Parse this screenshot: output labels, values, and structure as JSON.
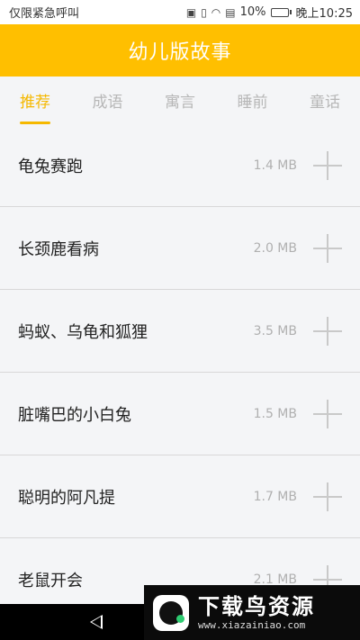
{
  "status_bar": {
    "carrier": "仅限紧急呼叫",
    "battery": "10%",
    "time": "晚上10:25",
    "battery_level": 0.1
  },
  "header": {
    "title": "幼儿版故事"
  },
  "tabs": [
    {
      "label": "推荐",
      "active": true
    },
    {
      "label": "成语",
      "active": false
    },
    {
      "label": "寓言",
      "active": false
    },
    {
      "label": "睡前",
      "active": false
    },
    {
      "label": "童话",
      "active": false
    }
  ],
  "stories": [
    {
      "title": "龟兔赛跑",
      "size": "1.4 MB"
    },
    {
      "title": "长颈鹿看病",
      "size": "2.0 MB"
    },
    {
      "title": "蚂蚁、乌龟和狐狸",
      "size": "3.5 MB"
    },
    {
      "title": "脏嘴巴的小白兔",
      "size": "1.5 MB"
    },
    {
      "title": "聪明的阿凡提",
      "size": "1.7 MB"
    },
    {
      "title": "老鼠开会",
      "size": "2.1 MB"
    }
  ],
  "watermark": {
    "title": "下载鸟资源",
    "url": "www.xiazainiao.com"
  },
  "colors": {
    "accent": "#ffbf00",
    "tab_active": "#f5b800",
    "battery_low": "#e53935"
  },
  "icons": [
    "nfc-icon",
    "vibrate-icon",
    "wifi-icon",
    "sim-icon",
    "battery-icon",
    "plus-icon",
    "back-icon"
  ]
}
